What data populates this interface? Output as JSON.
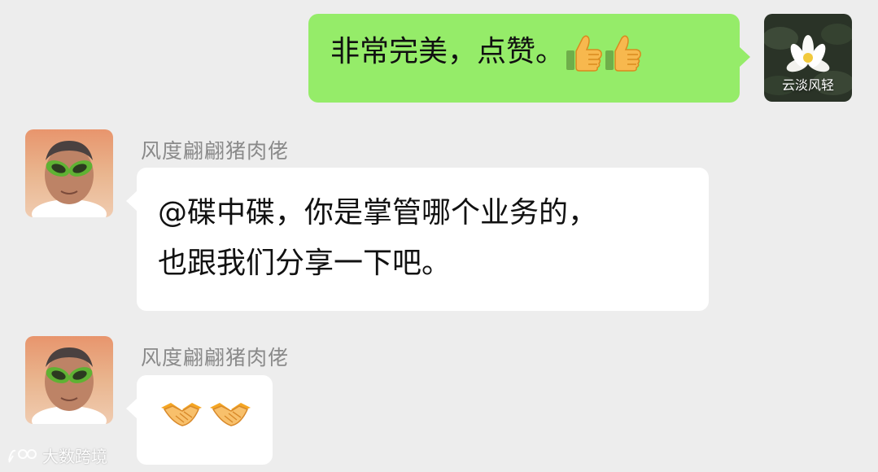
{
  "conversation": {
    "messages": [
      {
        "side": "right",
        "avatar_caption": "云淡风轻",
        "text": "非常完美，点赞。",
        "emojis": [
          "thumbs-up-icon",
          "thumbs-up-icon"
        ]
      },
      {
        "side": "left",
        "sender": "风度翩翩猪肉佬",
        "lines": [
          "@碟中碟，你是掌管哪个业务的，",
          "也跟我们分享一下吧。"
        ]
      },
      {
        "side": "left",
        "sender": "风度翩翩猪肉佬",
        "emojis": [
          "handshake-icon",
          "handshake-icon"
        ]
      }
    ]
  },
  "watermark": {
    "text": "大数跨境"
  },
  "colors": {
    "background": "#ededed",
    "self_bubble": "#95ec69",
    "other_bubble": "#ffffff",
    "sender_name": "#8a8a8a"
  }
}
